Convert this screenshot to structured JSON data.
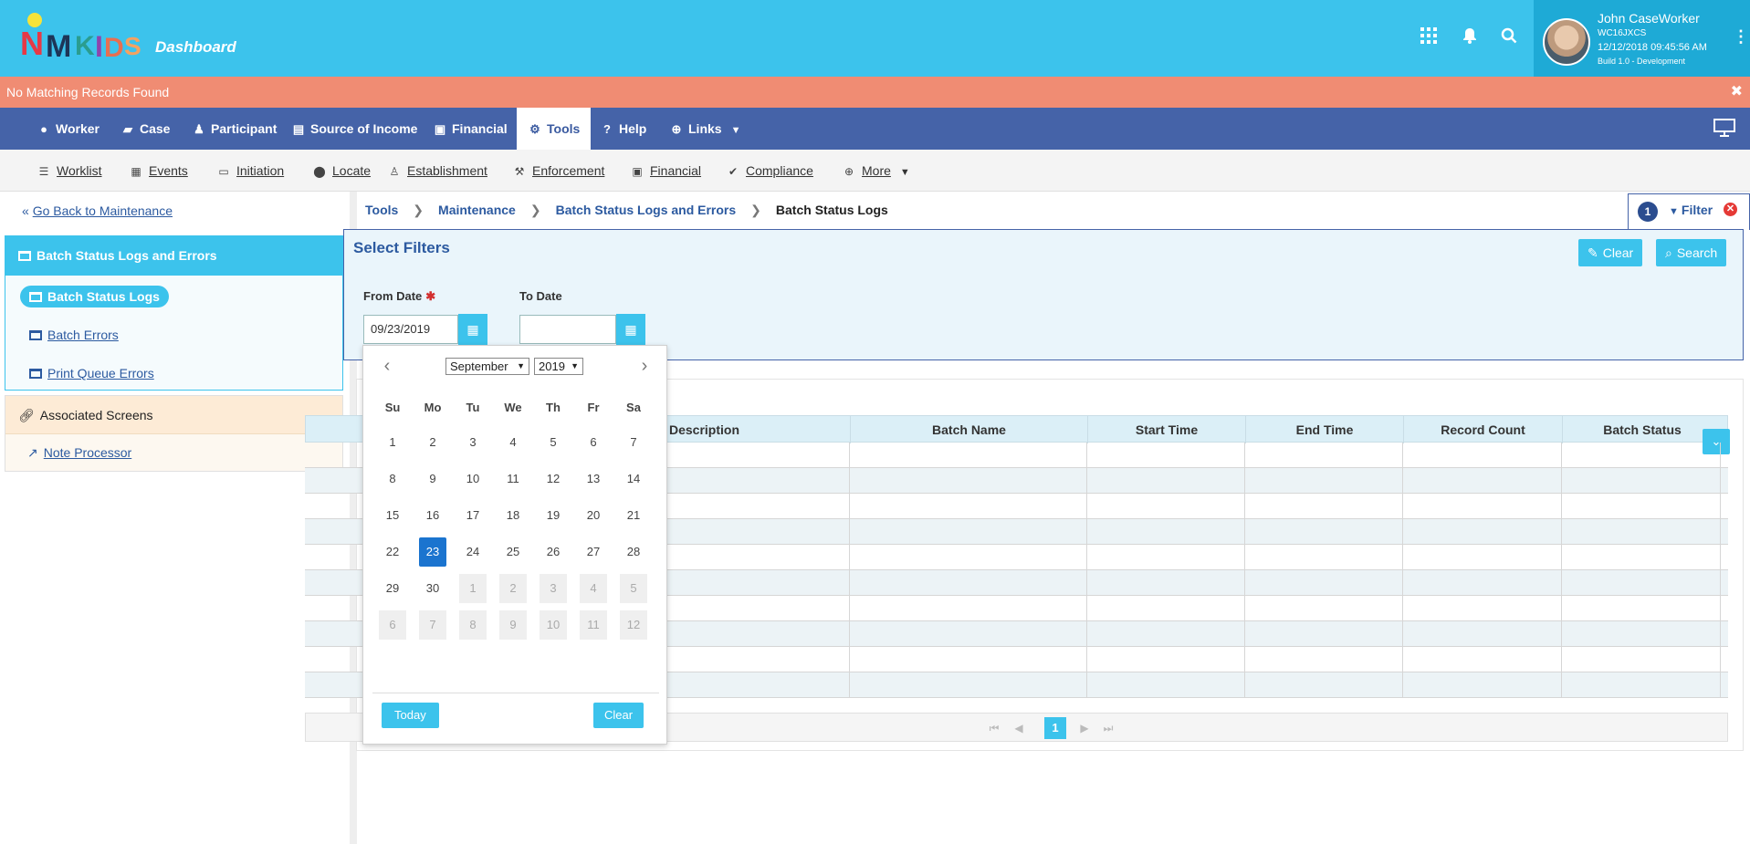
{
  "header": {
    "title": "Dashboard",
    "user_name": "John CaseWorker",
    "user_id": "WC16JXCS",
    "datetime": "12/12/2018 09:45:56 AM",
    "build": "Build 1.0 - Development"
  },
  "alert": {
    "message": "No Matching Records Found",
    "close": "✖"
  },
  "main_nav": {
    "items": [
      {
        "label": "Worker",
        "icon": "person-icon"
      },
      {
        "label": "Case",
        "icon": "folder-icon"
      },
      {
        "label": "Participant",
        "icon": "person-icon"
      },
      {
        "label": "Source of Income",
        "icon": "document-icon"
      },
      {
        "label": "Financial",
        "icon": "money-icon"
      },
      {
        "label": "Tools",
        "icon": "gears-icon"
      },
      {
        "label": "Help",
        "icon": "question-icon"
      },
      {
        "label": "Links",
        "icon": "plus-circle-icon"
      }
    ]
  },
  "sub_nav": {
    "items": [
      {
        "label": "Worklist"
      },
      {
        "label": "Events"
      },
      {
        "label": "Initiation"
      },
      {
        "label": "Locate"
      },
      {
        "label": "Establishment"
      },
      {
        "label": "Enforcement"
      },
      {
        "label": "Financial"
      },
      {
        "label": "Compliance"
      },
      {
        "label": "More"
      }
    ]
  },
  "sidebar": {
    "back_link": "Go Back to Maintenance",
    "group_title": "Batch Status Logs and Errors",
    "items": [
      {
        "label": "Batch Status Logs"
      },
      {
        "label": "Batch Errors"
      },
      {
        "label": "Print Queue Errors"
      }
    ],
    "associated_title": "Associated Screens",
    "associated_items": [
      {
        "label": "Note Processor"
      }
    ]
  },
  "breadcrumb": {
    "items": [
      "Tools",
      "Maintenance",
      "Batch Status Logs and Errors"
    ],
    "current": "Batch Status Logs"
  },
  "filter_tab": {
    "count": "1",
    "label": "Filter"
  },
  "filters": {
    "title": "Select Filters",
    "clear_label": "Clear",
    "search_label": "Search",
    "from_label": "From Date",
    "from_value": "09/23/2019",
    "to_label": "To Date",
    "to_value": ""
  },
  "grid": {
    "columns": [
      "Description",
      "Batch Name",
      "Start Time",
      "End Time",
      "Record Count",
      "Batch Status"
    ],
    "current_page": "1"
  },
  "datepicker": {
    "month": "September",
    "year": "2019",
    "days_of_week": [
      "Su",
      "Mo",
      "Tu",
      "We",
      "Th",
      "Fr",
      "Sa"
    ],
    "weeks": [
      [
        "1",
        "2",
        "3",
        "4",
        "5",
        "6",
        "7"
      ],
      [
        "8",
        "9",
        "10",
        "11",
        "12",
        "13",
        "14"
      ],
      [
        "15",
        "16",
        "17",
        "18",
        "19",
        "20",
        "21"
      ],
      [
        "22",
        "23",
        "24",
        "25",
        "26",
        "27",
        "28"
      ],
      [
        "29",
        "30",
        "1",
        "2",
        "3",
        "4",
        "5"
      ],
      [
        "6",
        "7",
        "8",
        "9",
        "10",
        "11",
        "12"
      ]
    ],
    "selected_day": "23",
    "today_label": "Today",
    "clear_label": "Clear"
  },
  "colors": {
    "header_bg": "#3cc3ec",
    "nav_bg": "#4563a8",
    "alert_bg": "#f08c73",
    "selected_day": "#1b74cf"
  }
}
